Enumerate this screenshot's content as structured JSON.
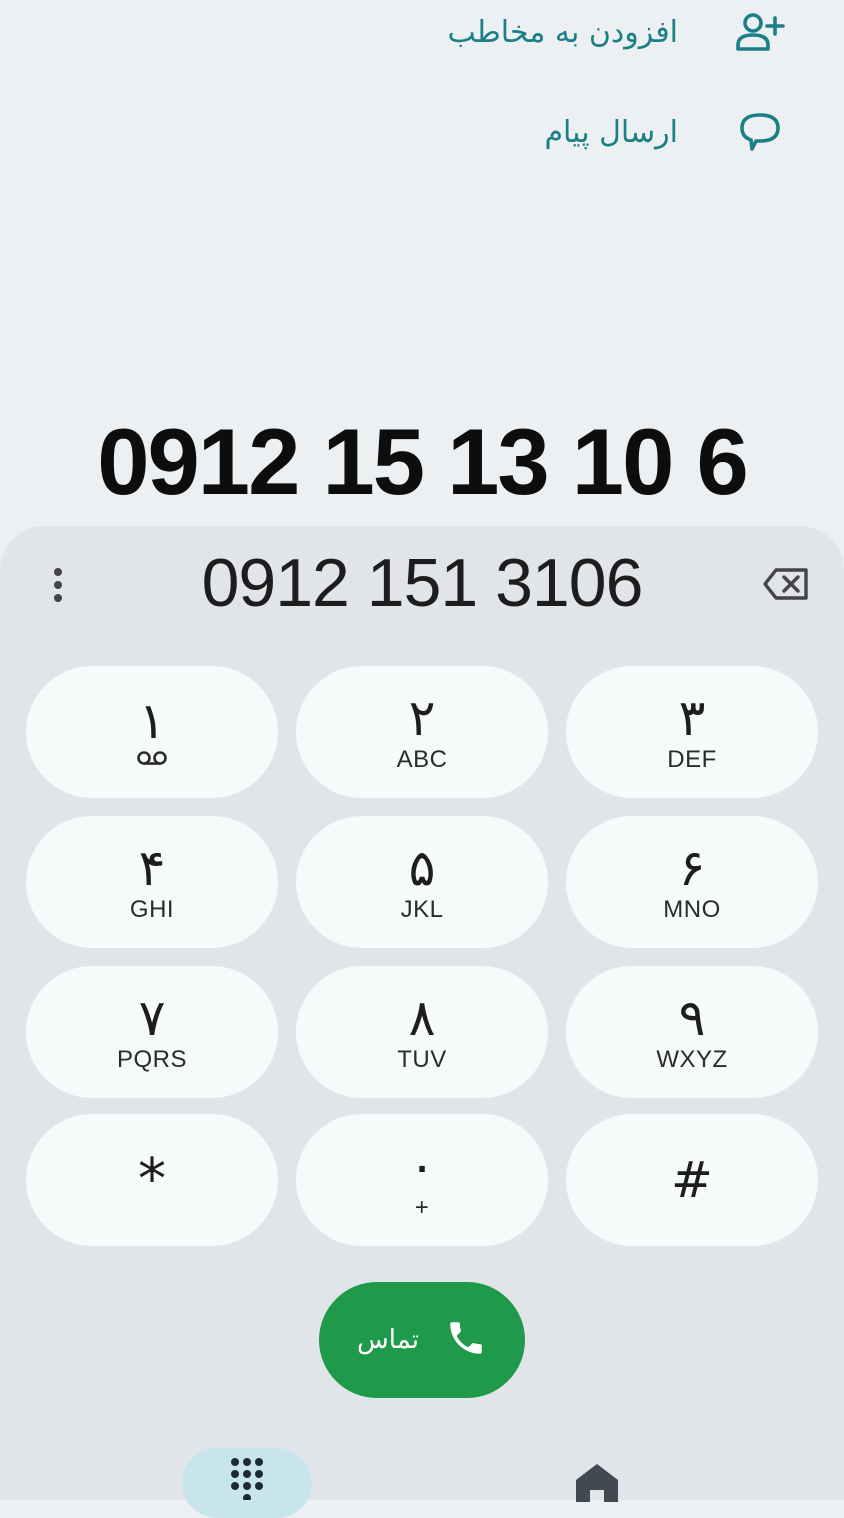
{
  "actions": {
    "add_contact_label": "افزودن به مخاطب",
    "send_message_label": "ارسال پیام"
  },
  "display": {
    "formatted_number": "0912 15 13 10 6",
    "entered_number": "0912 151 3106"
  },
  "keypad": {
    "keys": [
      {
        "digit": "۱",
        "letters": ""
      },
      {
        "digit": "۲",
        "letters": "ABC"
      },
      {
        "digit": "۳",
        "letters": "DEF"
      },
      {
        "digit": "۴",
        "letters": "GHI"
      },
      {
        "digit": "۵",
        "letters": "JKL"
      },
      {
        "digit": "۶",
        "letters": "MNO"
      },
      {
        "digit": "۷",
        "letters": "PQRS"
      },
      {
        "digit": "۸",
        "letters": "TUV"
      },
      {
        "digit": "۹",
        "letters": "WXYZ"
      },
      {
        "digit": "*",
        "letters": ""
      },
      {
        "digit": "۰",
        "letters": "+"
      },
      {
        "digit": "#",
        "letters": ""
      }
    ]
  },
  "call": {
    "label": "تماس"
  },
  "icons": {
    "add_contact": "person-add-icon",
    "message": "message-bubble-icon",
    "menu": "more-vert-icon",
    "backspace": "backspace-icon",
    "voicemail": "voicemail-icon",
    "call": "phone-icon",
    "keypad_nav": "dialpad-icon",
    "home_nav": "home-icon"
  },
  "colors": {
    "accent_teal": "#1b7f86",
    "call_green": "#1f9a4a",
    "background": "#edf0f3",
    "pad_panel": "#e1e5e9",
    "key_bg": "#f6fafb",
    "nav_active": "#c9e5ec"
  }
}
